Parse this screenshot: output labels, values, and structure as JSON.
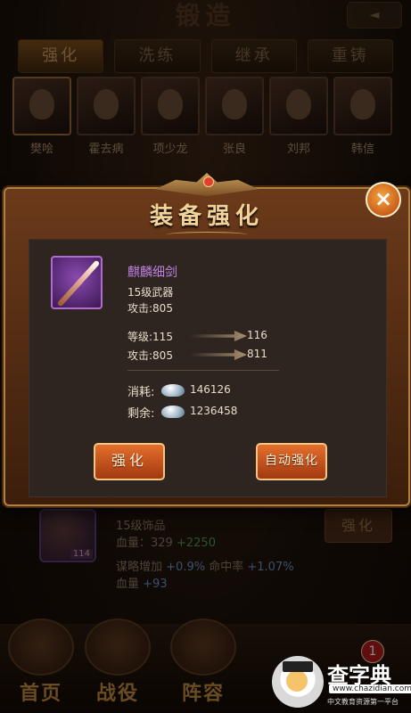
{
  "screen": {
    "title": "锻造",
    "tabs": [
      "强化",
      "洗练",
      "继承",
      "重铸"
    ],
    "heroes": [
      "樊哙",
      "霍去病",
      "项少龙",
      "张良",
      "刘邦",
      "韩信"
    ]
  },
  "background_item": {
    "level_badge": "114",
    "type": "15级饰品",
    "hp_label": "血量：",
    "hp_value": "329",
    "hp_bonus": "+2250",
    "extra_line1_label": "谋略增加",
    "extra_line1_value": "+0.9%",
    "extra_line1_label2": "命中率",
    "extra_line1_value2": "+1.07%",
    "extra_line2_label": "血量",
    "extra_line2_value": "+93",
    "button": "强化"
  },
  "nav": {
    "items": [
      "首页",
      "战役",
      "阵容"
    ],
    "badge": "1"
  },
  "watermark": {
    "title": "查字典",
    "url": "www.chazidian.com",
    "sub": "中文教育资源第一平台"
  },
  "dialog": {
    "title": "装备强化",
    "close": "×",
    "item": {
      "name": "麒麟细剑",
      "type": "15级武器",
      "attack_line": "攻击:805"
    },
    "upgrade": {
      "level_current": "等级:115",
      "level_next": "116",
      "attack_current": "攻击:805",
      "attack_next": "811"
    },
    "cost": {
      "consume_label": "消耗:",
      "consume_value": "146126",
      "remain_label": "剩余:",
      "remain_value": "1236458"
    },
    "buttons": {
      "upgrade": "强化",
      "auto_upgrade": "自动强化"
    }
  },
  "colors": {
    "accent": "#c080e0",
    "button": "#d45a1f",
    "frame": "#b08040"
  }
}
